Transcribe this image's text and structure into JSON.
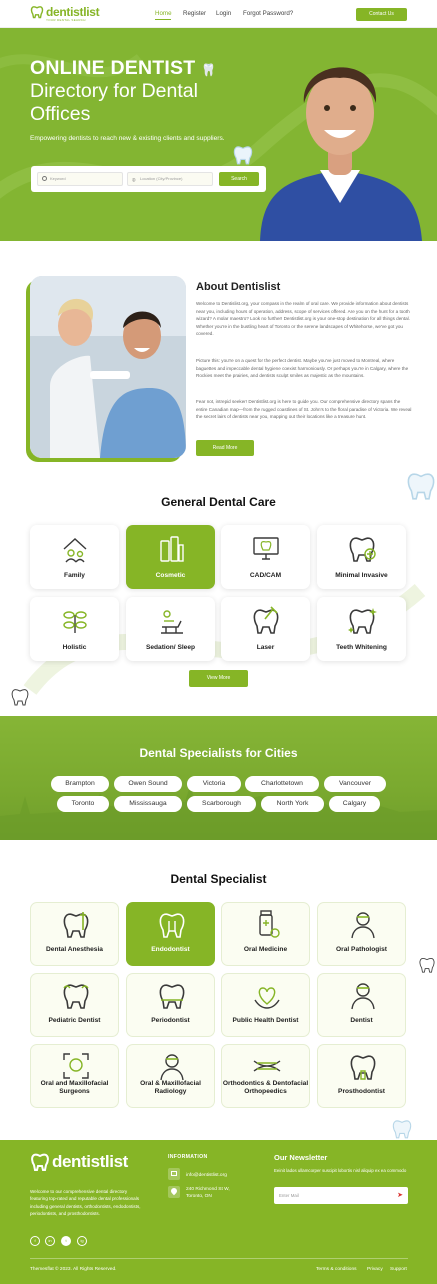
{
  "header": {
    "logo_text": "dentistlist",
    "logo_tagline": "YOUR DENTAL SEARCH",
    "nav": [
      "Home",
      "Register",
      "Login",
      "Forgot Password?"
    ],
    "contact_label": "Contact Us"
  },
  "hero": {
    "title_bold": "ONLINE DENTIST",
    "title_rest": "Directory for Dental Offices",
    "subtitle": "Empowering dentists to reach new & existing clients and suppliers.",
    "keyword_placeholder": "Keyword",
    "location_placeholder": "Location (City/Province)",
    "search_label": "Search"
  },
  "about": {
    "title": "About Dentislist",
    "paragraphs": [
      "Welcome to Dentislist.org, your compass in the realm of oral care. We provide information about dentists near you, including hours of operation, address, scope of services offered. Are you on the hunt for a tooth wizard? A molar maestro? Look no further! Dentistlist.org is your one-stop destination for all things dental. Whether you're in the bustling heart of Toronto or the serene landscapes of Whitehorse, we've got you covered.",
      "Picture this: you're on a quest for the perfect dentist. Maybe you've just moved to Montreal, where baguettes and impeccable dental hygiene coexist harmoniously. Or perhaps you're in Calgary, where the Rockies meet the prairies, and dentists sculpt smiles as majestic as the mountains.",
      "Fear not, intrepid seeker! Dentistlist.org is here to guide you. Our comprehensive directory spans the entire Canadian map—from the rugged coastlines of St. John's to the floral paradise of Victoria. We reveal the secret lairs of dentists near you, mapping out their locations like a treasure hunt."
    ],
    "read_more_label": "Read More"
  },
  "general": {
    "title": "General Dental Care",
    "items": [
      {
        "label": "Family",
        "icon": "family-house-icon"
      },
      {
        "label": "Cosmetic",
        "icon": "cosmetic-products-icon"
      },
      {
        "label": "CAD/CAM",
        "icon": "monitor-tooth-icon"
      },
      {
        "label": "Minimal Invasive",
        "icon": "tooth-plus-icon"
      },
      {
        "label": "Holistic",
        "icon": "leaves-icon"
      },
      {
        "label": "Sedation/ Sleep",
        "icon": "dentist-chair-icon"
      },
      {
        "label": "Laser",
        "icon": "laser-tooth-icon"
      },
      {
        "label": "Teeth Whitening",
        "icon": "sparkle-tooth-icon"
      }
    ],
    "view_more_label": "View More"
  },
  "cities": {
    "title": "Dental Specialists for Cities",
    "row1": [
      "Brampton",
      "Owen Sound",
      "Victoria",
      "Charlottetown",
      "Vancouver"
    ],
    "row2": [
      "Toronto",
      "Mississauga",
      "Scarborough",
      "North York",
      "Calgary"
    ]
  },
  "specialist": {
    "title": "Dental Specialist",
    "items": [
      {
        "label": "Dental Anesthesia",
        "icon": "syringe-tooth-icon"
      },
      {
        "label": "Endodontist",
        "icon": "root-canal-icon"
      },
      {
        "label": "Oral Medicine",
        "icon": "medicine-bottle-icon"
      },
      {
        "label": "Oral Pathologist",
        "icon": "doctor-icon"
      },
      {
        "label": "Pediatric Dentist",
        "icon": "child-tooth-icon"
      },
      {
        "label": "Periodontist",
        "icon": "gum-tooth-icon"
      },
      {
        "label": "Public Health Dentist",
        "icon": "heart-hands-icon"
      },
      {
        "label": "Dentist",
        "icon": "dentist-person-icon"
      },
      {
        "label": "Oral and Maxillofacial Surgeons",
        "icon": "scan-face-icon"
      },
      {
        "label": "Oral & Maxillofacial Radiology",
        "icon": "radiology-doctor-icon"
      },
      {
        "label": "Orthodontics & Dentofacial Orthopeedics",
        "icon": "braces-icon"
      },
      {
        "label": "Prosthodontist",
        "icon": "implant-icon"
      }
    ]
  },
  "footer": {
    "description": "Welcome to our comprehensive dental directory featuring top-rated and reputable dental professionals including general dentists, orthodontists, endodontists, periodontists, and prosthodontists.",
    "info_heading": "INFORMATION",
    "email": "info@dentistlist.org",
    "address_line1": "240 Richmond St W,",
    "address_line2": "Toronto, ON",
    "newsletter_heading": "Our Newsletter",
    "newsletter_text": "Eeinit lados ullamcorper suscipit lobortis nisl aliquip ex ea commodo",
    "email_placeholder": "Enter Mail",
    "copyright": "Themesflat © 2023. All Rights Reserved.",
    "links": [
      "Terms & conditions",
      "Privacy",
      "Support"
    ],
    "social": [
      "f",
      "in",
      "t",
      "ig"
    ]
  },
  "colors": {
    "brand": "#86b526",
    "text": "#222222"
  }
}
